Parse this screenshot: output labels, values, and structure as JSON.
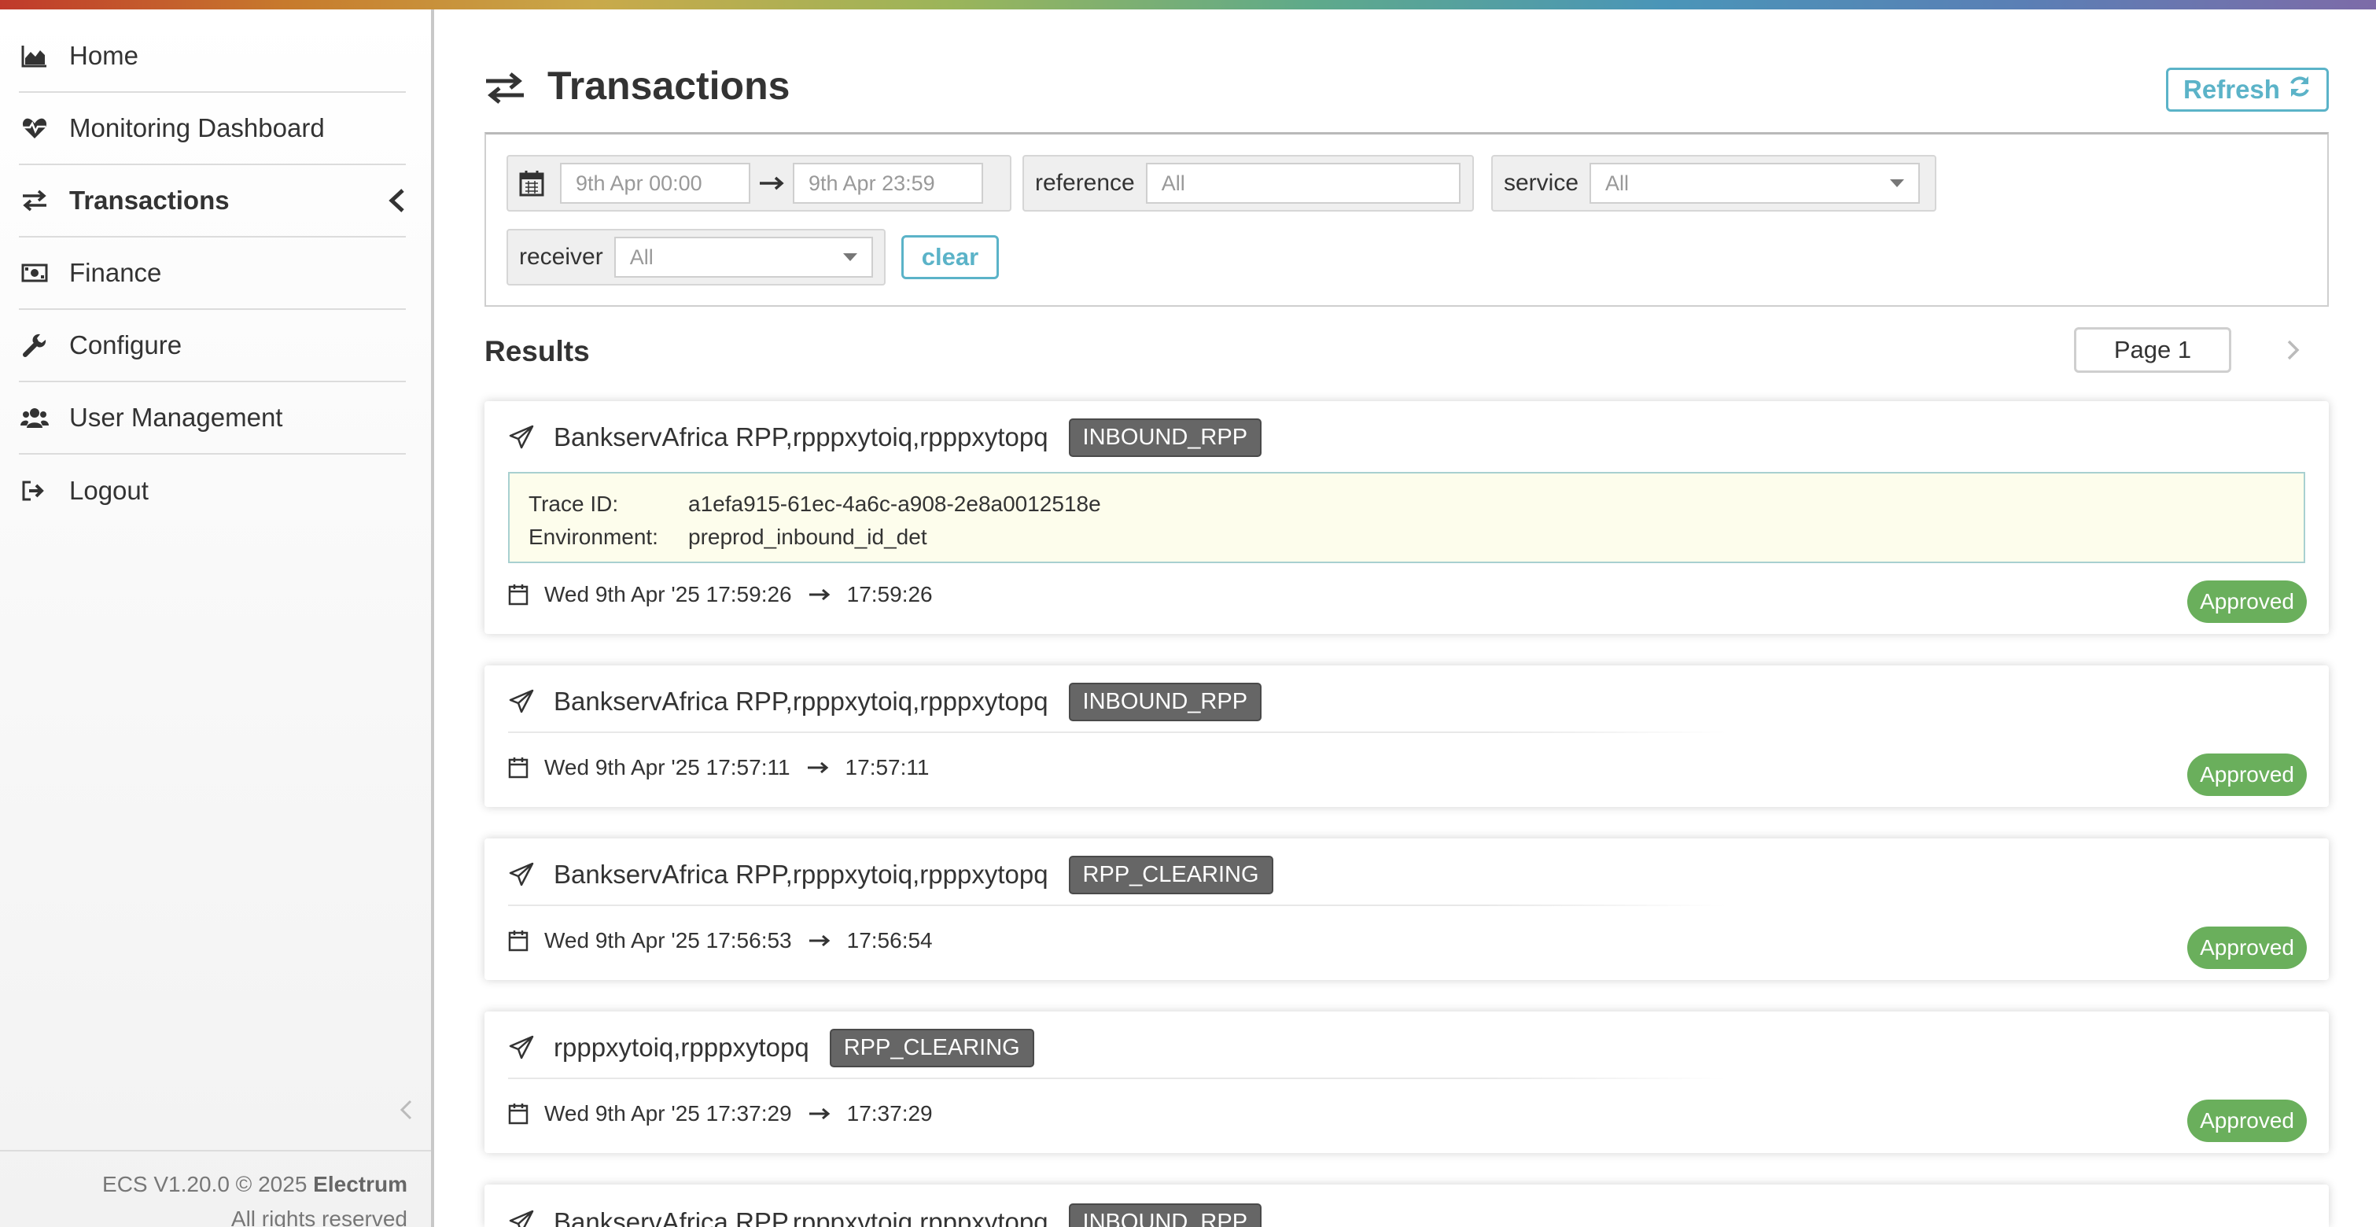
{
  "sidebar": {
    "items": [
      {
        "label": "Home",
        "icon": "area-chart-icon"
      },
      {
        "label": "Monitoring Dashboard",
        "icon": "heartbeat-icon"
      },
      {
        "label": "Transactions",
        "icon": "exchange-icon",
        "active": true
      },
      {
        "label": "Finance",
        "icon": "money-icon"
      },
      {
        "label": "Configure",
        "icon": "wrench-icon"
      },
      {
        "label": "User Management",
        "icon": "users-icon"
      },
      {
        "label": "Logout",
        "icon": "sign-out-icon"
      }
    ],
    "footer": {
      "version": "ECS V1.20.0 © 2025 ",
      "brand": "Electrum",
      "rights": "All rights reserved"
    }
  },
  "header": {
    "title": "Transactions",
    "refresh_label": "Refresh"
  },
  "filters": {
    "date_from": "9th Apr 00:00",
    "date_to": "9th Apr 23:59",
    "reference_label": "reference",
    "reference_placeholder": "All",
    "service_label": "service",
    "service_value": "All",
    "receiver_label": "receiver",
    "receiver_value": "All",
    "clear_label": "clear"
  },
  "results": {
    "title": "Results",
    "page_label": "Page 1"
  },
  "transactions": [
    {
      "title": "BankservAfrica RPP,rpppxytoiq,rpppxytopq",
      "tag": "INBOUND_RPP",
      "trace_id_label": "Trace ID:",
      "trace_id": "a1efa915-61ec-4a6c-a908-2e8a0012518e",
      "env_label": "Environment:",
      "environment": "preprod_inbound_id_det",
      "start": "Wed 9th Apr '25 17:59:26",
      "end": "17:59:26",
      "status": "Approved"
    },
    {
      "title": "BankservAfrica RPP,rpppxytoiq,rpppxytopq",
      "tag": "INBOUND_RPP",
      "start": "Wed 9th Apr '25 17:57:11",
      "end": "17:57:11",
      "status": "Approved"
    },
    {
      "title": "BankservAfrica RPP,rpppxytoiq,rpppxytopq",
      "tag": "RPP_CLEARING",
      "start": "Wed 9th Apr '25 17:56:53",
      "end": "17:56:54",
      "status": "Approved"
    },
    {
      "title": "rpppxytoiq,rpppxytopq",
      "tag": "RPP_CLEARING",
      "start": "Wed 9th Apr '25 17:37:29",
      "end": "17:37:29",
      "status": "Approved"
    },
    {
      "title": "BankservAfrica RPP,rpppxytoiq,rpppxytopq",
      "tag": "INBOUND_RPP"
    }
  ],
  "colors": {
    "accent": "#5bb3c8",
    "approved": "#6aaf5c",
    "tag": "#666666"
  }
}
